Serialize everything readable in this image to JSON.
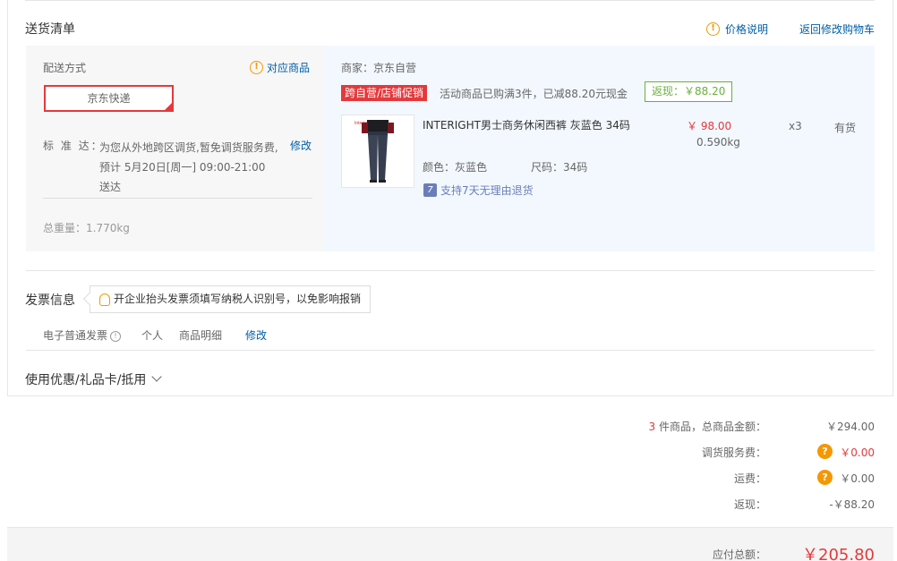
{
  "delivery": {
    "section_title": "送货清单",
    "price_explain": "价格说明",
    "back_to_cart": "返回修改购物车",
    "ship_mode_label": "配送方式",
    "match_goods": "对应商品",
    "express": "京东快递",
    "standard_label": "标 准 达：",
    "standard_lines": [
      "为您从外地跨区调货,暂免调货服务费,",
      "预计 5月20日[周一] 09:00-21:00",
      "送达"
    ],
    "modify": "修改",
    "total_weight": "总重量：1.770kg"
  },
  "product_block": {
    "merchant": "商家：京东自营",
    "promo_tag": "跨自营/店铺促销",
    "promo_text": "活动商品已购满3件，已减88.20元现金",
    "rebate": "返现：￥88.20",
    "item": {
      "image_brand": "Interight",
      "name": "INTERIGHT男士商务休闲西裤 灰蓝色 34码",
      "price": "￥ 98.00",
      "weight": "0.590kg",
      "qty": "x3",
      "stock": "有货",
      "color": "颜色：灰蓝色",
      "size": "尺码：34码",
      "return_policy": "支持7天无理由退货"
    }
  },
  "invoice": {
    "title": "发票信息",
    "tip": "开企业抬头发票须填写纳税人识别号，以免影响报销",
    "type": "电子普通发票",
    "person": "个人",
    "detail": "商品明细",
    "modify": "修改"
  },
  "coupon": {
    "label": "使用优惠/礼品卡/抵用"
  },
  "summary": {
    "count": "3",
    "goods_label": " 件商品，总商品金额：",
    "goods_amount": "￥294.00",
    "service_fee_label": "调货服务费：",
    "service_fee": "￥0.00",
    "freight_label": "运费：",
    "freight": "￥0.00",
    "rebate_label": "返现：",
    "rebate": "-￥88.20",
    "payable_label": "应付总额：",
    "payable": "￥205.80"
  },
  "colors": {
    "accent_red": "#e4393c",
    "link_blue": "#005ea7",
    "warn_orange": "#f39800",
    "green": "#6ab03d"
  },
  "icons": [
    "info-circle-icon",
    "question-icon",
    "bulb-icon",
    "return-7day-icon",
    "chevron-down-icon",
    "checkmark-icon"
  ]
}
